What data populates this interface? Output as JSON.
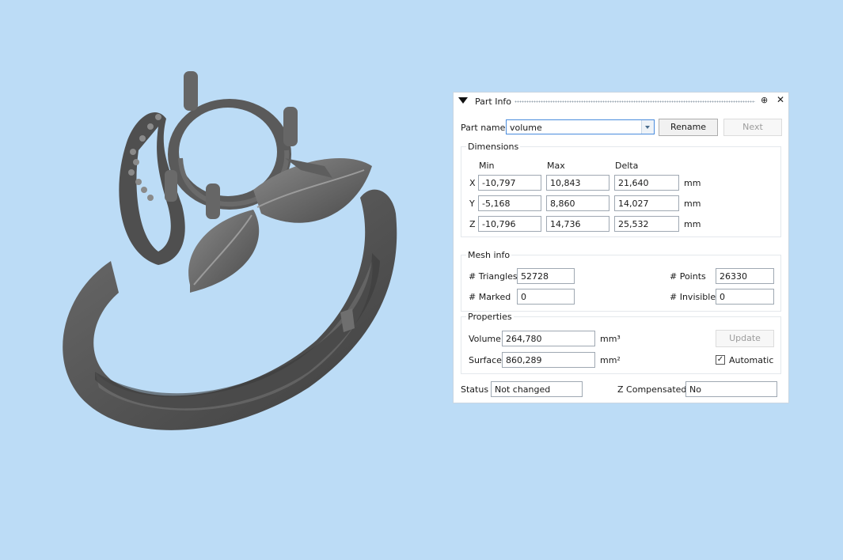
{
  "panel": {
    "title": "Part Info",
    "pin_glyph": "⊕",
    "close_glyph": "✕",
    "part_name_label": "Part name",
    "part_name_value": "volume",
    "rename_label": "Rename",
    "next_label": "Next"
  },
  "dimensions": {
    "title": "Dimensions",
    "headers": [
      "Min",
      "Max",
      "Delta"
    ],
    "rows": [
      {
        "axis": "X",
        "min": "-10,797",
        "max": "10,843",
        "delta": "21,640",
        "unit": "mm"
      },
      {
        "axis": "Y",
        "min": "-5,168",
        "max": "8,860",
        "delta": "14,027",
        "unit": "mm"
      },
      {
        "axis": "Z",
        "min": "-10,796",
        "max": "14,736",
        "delta": "25,532",
        "unit": "mm"
      }
    ]
  },
  "mesh_info": {
    "title": "Mesh info",
    "triangles_label": "# Triangles",
    "triangles_value": "52728",
    "points_label": "# Points",
    "points_value": "26330",
    "marked_label": "# Marked",
    "marked_value": "0",
    "invisible_label": "# Invisible",
    "invisible_value": "0"
  },
  "properties": {
    "title": "Properties",
    "volume_label": "Volume",
    "volume_value": "264,780",
    "volume_unit": "mm³",
    "update_label": "Update",
    "surface_label": "Surface",
    "surface_value": "860,289",
    "surface_unit": "mm²",
    "automatic_label": "Automatic",
    "automatic_checked": true
  },
  "status": {
    "status_label": "Status",
    "status_value": "Not changed",
    "z_label": "Z Compensated",
    "z_value": "No"
  },
  "colors": {
    "background": "#bcdcf6",
    "model": "#5f5f5f",
    "accent": "#4a8cdd"
  },
  "icons": {
    "collapse": "collapse-triangle-icon",
    "pin": "pin-icon",
    "close": "close-icon",
    "dropdown": "chevron-down-icon",
    "check": "checkmark-icon"
  }
}
